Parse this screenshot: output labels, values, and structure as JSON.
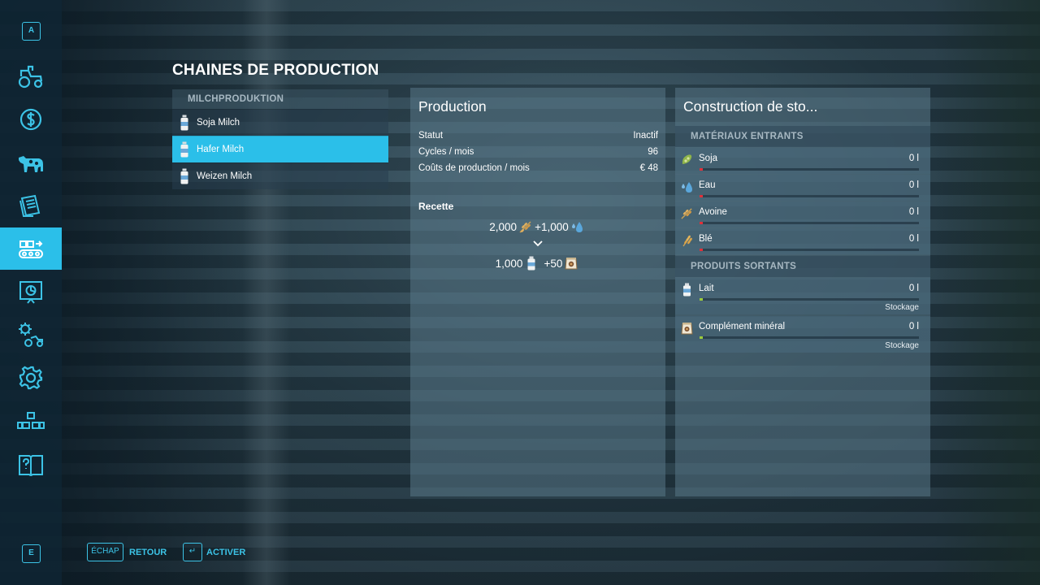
{
  "sidebar": {
    "top_key": "A",
    "bottom_key": "E",
    "items": [
      {
        "icon": "tractor-icon"
      },
      {
        "icon": "finance-icon"
      },
      {
        "icon": "cow-icon"
      },
      {
        "icon": "contracts-icon"
      },
      {
        "icon": "production-icon",
        "active": true
      },
      {
        "icon": "statistics-icon"
      },
      {
        "icon": "vehicle-settings-icon"
      },
      {
        "icon": "settings-icon"
      },
      {
        "icon": "hierarchy-icon"
      },
      {
        "icon": "help-book-icon"
      }
    ],
    "accent_color": "#2bbfe9"
  },
  "page_title": "CHAINES DE PRODUCTION",
  "chains": {
    "group_header": "MILCHPRODUKTION",
    "items": [
      {
        "label": "Soja Milch",
        "icon": "milk-bottle-icon"
      },
      {
        "label": "Hafer Milch",
        "icon": "milk-bottle-icon",
        "selected": true
      },
      {
        "label": "Weizen Milch",
        "icon": "milk-bottle-icon"
      }
    ]
  },
  "production": {
    "title": "Production",
    "stats": [
      {
        "label": "Statut",
        "value": "Inactif"
      },
      {
        "label": "Cycles / mois",
        "value": "96"
      },
      {
        "label": "Coûts de production / mois",
        "value": "€ 48"
      }
    ],
    "recipe_label": "Recette",
    "recipe_inputs": [
      {
        "amount": "2,000",
        "icon": "oat-icon"
      },
      {
        "amount": "+1,000",
        "icon": "water-drop-icon"
      }
    ],
    "recipe_outputs": [
      {
        "amount": "1,000",
        "icon": "milk-bottle-icon"
      },
      {
        "amount": "+50",
        "icon": "mineral-bag-icon"
      }
    ]
  },
  "storage": {
    "title": "Construction de sto...",
    "inputs_header": "MATÉRIAUX ENTRANTS",
    "inputs": [
      {
        "name": "Soja",
        "amount": "0 l",
        "icon": "soy-icon",
        "fill": 0
      },
      {
        "name": "Eau",
        "amount": "0 l",
        "icon": "water-drop-icon",
        "fill": 0
      },
      {
        "name": "Avoine",
        "amount": "0 l",
        "icon": "oat-icon",
        "fill": 0
      },
      {
        "name": "Blé",
        "amount": "0 l",
        "icon": "wheat-icon",
        "fill": 0
      }
    ],
    "outputs_header": "PRODUITS SORTANTS",
    "outputs": [
      {
        "name": "Lait",
        "amount": "0 l",
        "icon": "milk-bottle-icon",
        "fill": 0,
        "mode": "Stockage"
      },
      {
        "name": "Complément minéral",
        "amount": "0 l",
        "icon": "mineral-bag-icon",
        "fill": 0,
        "mode": "Stockage"
      }
    ],
    "input_bar_color": "#e0303a",
    "output_bar_color": "#9ccc3a"
  },
  "footer": {
    "back_key": "ÉCHAP",
    "back_label": "RETOUR",
    "activate_key": "↵",
    "activate_label": "ACTIVER"
  }
}
